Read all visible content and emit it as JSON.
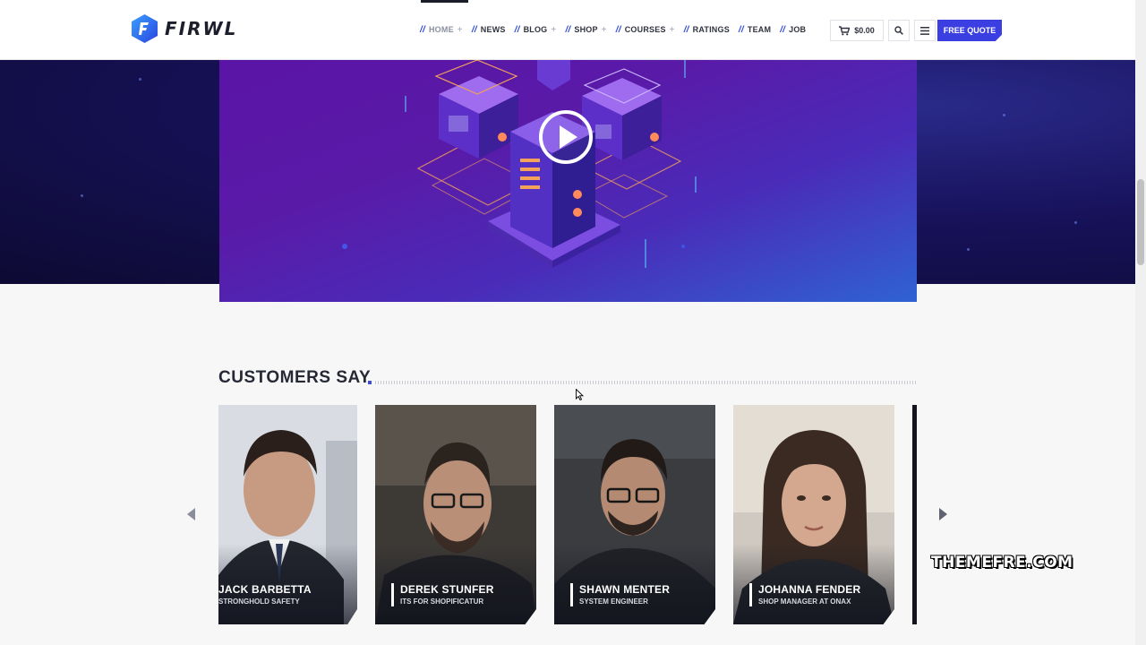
{
  "header": {
    "logo_text": "FIRWL",
    "nav": [
      {
        "label": "HOME",
        "has_submenu": true,
        "active": true
      },
      {
        "label": "NEWS",
        "has_submenu": false,
        "active": false
      },
      {
        "label": "BLOG",
        "has_submenu": true,
        "active": false
      },
      {
        "label": "SHOP",
        "has_submenu": true,
        "active": false
      },
      {
        "label": "COURSES",
        "has_submenu": true,
        "active": false
      },
      {
        "label": "RATINGS",
        "has_submenu": false,
        "active": false
      },
      {
        "label": "TEAM",
        "has_submenu": false,
        "active": false
      },
      {
        "label": "JOB",
        "has_submenu": false,
        "active": false
      }
    ],
    "nav_prefix": "//",
    "submenu_symbol": "+",
    "cart_total": "$0.00",
    "quote_button": "FREE QUOTE"
  },
  "video": {
    "play_icon": "play-icon"
  },
  "customers": {
    "title": "CUSTOMERS SAY",
    "items": [
      {
        "name": "JACK BARBETTA",
        "role": "STRONGHOLD SAFETY"
      },
      {
        "name": "DEREK STUNFER",
        "role": "ITS FOR SHOPIFICATUR"
      },
      {
        "name": "SHAWN MENTER",
        "role": "SYSTEM ENGINEER"
      },
      {
        "name": "JOHANNA FENDER",
        "role": "SHOP MANAGER AT ONAX"
      }
    ]
  },
  "watermark": "THEMEFRE.COM",
  "colors": {
    "accent": "#3b3fe2",
    "nav_slash": "#3048d8",
    "hero_dark": "#17125a",
    "video_purple": "#5a14a6"
  }
}
